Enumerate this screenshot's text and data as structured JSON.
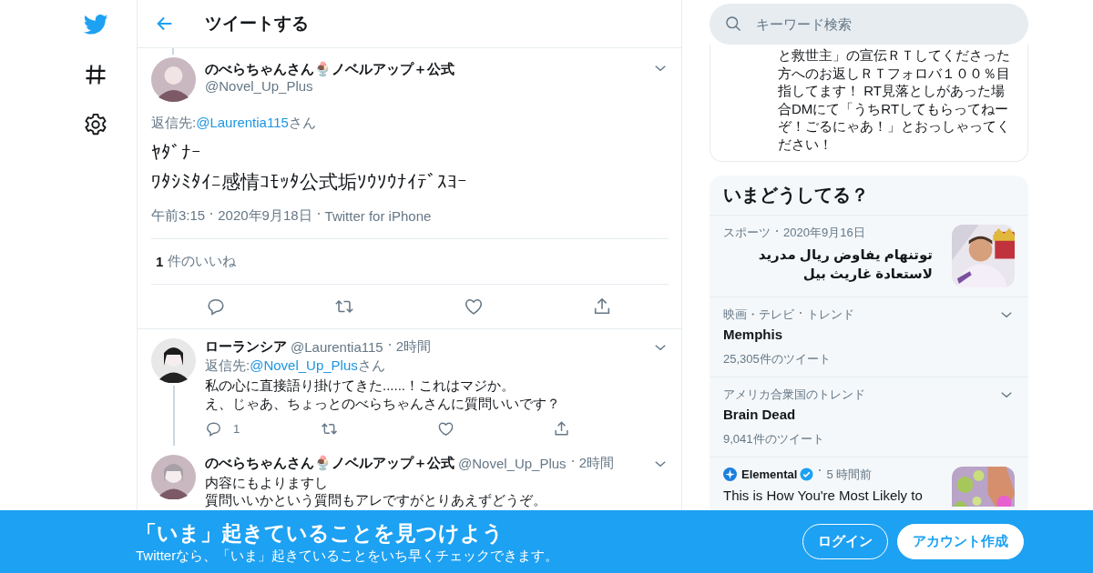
{
  "header": {
    "title": "ツイートする"
  },
  "main_tweet": {
    "connected_above": true,
    "name": "のべらちゃんさん🍨ノベルアップ＋公式",
    "handle": "@Novel_Up_Plus",
    "reply_label": "返信先:",
    "reply_to": "@Laurentia115",
    "reply_suffix": "さん",
    "lines": [
      "ﾔﾀﾞﾅｰ",
      "ﾜﾀｼﾐﾀｲﾆ感情ｺﾓｯﾀ公式垢ｿｳｿｳﾅｲﾃﾞｽﾖｰ"
    ],
    "time": "午前3:15",
    "date": "2020年9月18日",
    "source": "Twitter for iPhone",
    "like_count": "1",
    "like_label": "件のいいね"
  },
  "replies": [
    {
      "connected": true,
      "name": "ローランシア",
      "handle": "@Laurentia115",
      "time": "2時間",
      "reply_label": "返信先:",
      "reply_to": "@Novel_Up_Plus",
      "reply_suffix": "さん",
      "lines": [
        "私の心に直接語り掛けてきた......！これはマジか。",
        "え、じゃあ、ちょっとのべらちゃんさんに質問いいです？"
      ],
      "reply_count": "1"
    },
    {
      "connected": false,
      "name": "のべらちゃんさん🍨ノベルアップ＋公式",
      "handle": "@Novel_Up_Plus",
      "time": "2時間",
      "lines": [
        "内容にもよりますし",
        "質問いいかという質問もアレですがとりあえずどうぞ。"
      ]
    }
  ],
  "search": {
    "placeholder": "キーワード検索"
  },
  "promo_card": {
    "lines": [
      "と救世主」の宣伝ＲＴしてくださった",
      "方へのお返しＲＴフォロバ１００％目",
      "指してます！ RT見落としがあった場",
      "合DMにて「うちRTしてもらってねー",
      "ぞ！ごるにゃあ！」とおっしゃってく",
      "ださい！"
    ]
  },
  "trends": {
    "title": "いまどうしてる？",
    "items": [
      {
        "kind": "news",
        "category": "スポーツ",
        "date": "2020年9月16日",
        "headline": "توتنهام يفاوض ريال مدريد لاستعادة غاريث بيل"
      },
      {
        "kind": "trend",
        "context": [
          "映画・テレビ",
          "トレンド"
        ],
        "name": "Memphis",
        "count": "25,305件のツイート"
      },
      {
        "kind": "trend",
        "context": [
          "アメリカ合衆国のトレンド"
        ],
        "name": "Brain Dead",
        "count": "9,041件のツイート"
      },
      {
        "kind": "story",
        "source": "Elemental",
        "verified": true,
        "time": "5 時間前",
        "headline": "This is How You're Most Likely to"
      }
    ]
  },
  "banner": {
    "title": "「いま」起きていることを見つけよう",
    "subtitle": "Twitterなら、「いま」起きていることをいち早くチェックできます。",
    "buttons": [
      {
        "label": "ログイン",
        "kind": "outline"
      },
      {
        "label": "アカウント作成",
        "kind": "filled"
      }
    ]
  }
}
